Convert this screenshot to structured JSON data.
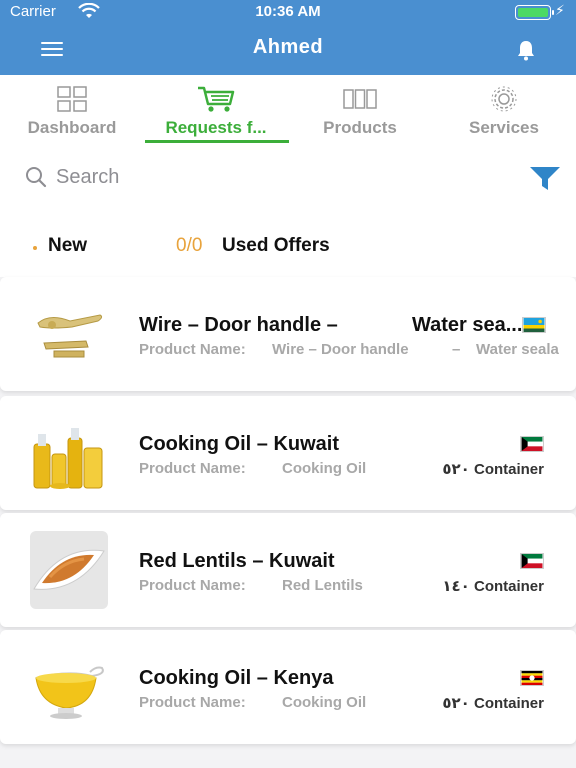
{
  "status_bar": {
    "carrier": "Carrier",
    "time": "10:36 AM"
  },
  "header": {
    "title": "Ahmed"
  },
  "tabs": [
    {
      "label": "Dashboard",
      "icon": "dashboard-grid-icon"
    },
    {
      "label": "Requests f...",
      "icon": "cart-icon",
      "active": true
    },
    {
      "label": "Products",
      "icon": "products-icon"
    },
    {
      "label": "Services",
      "icon": "gear-icon"
    }
  ],
  "search": {
    "placeholder": "Search"
  },
  "info": {
    "new_label": "New",
    "offers_count": "0/0",
    "offers_label": "Used Offers"
  },
  "colors": {
    "header_blue": "#4a8fd0",
    "active_green": "#3cae3a",
    "accent_orange": "#e8a33c"
  },
  "requests": [
    {
      "title": "Wire – Door handle   –",
      "title_extra": "Water sea...",
      "product_label": "Product Name:",
      "product_name": "Wire – Door handle",
      "product_dash": "–",
      "product_name_extra": "Water seala",
      "quantity": "",
      "flag": "rwanda-flag"
    },
    {
      "title": "Cooking Oil – Kuwait",
      "product_label": "Product Name:",
      "product_name": "Cooking Oil",
      "quantity": "٥٢٠ Container",
      "flag": "kuwait-flag"
    },
    {
      "title": "Red Lentils – Kuwait",
      "product_label": "Product Name:",
      "product_name": "Red Lentils",
      "quantity": "١٤٠ Container",
      "flag": "kuwait-flag"
    },
    {
      "title": "Cooking Oil – Kenya",
      "product_label": "Product Name:",
      "product_name": "Cooking Oil",
      "quantity": "٥٢٠ Container",
      "flag": "uganda-flag"
    }
  ]
}
